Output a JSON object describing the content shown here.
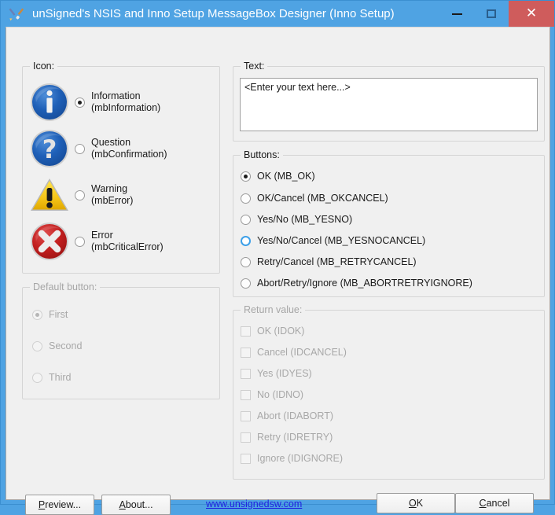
{
  "window": {
    "title": "unSigned's NSIS and Inno Setup MessageBox Designer (Inno Setup)",
    "app_icon": "paintbrush-pencil-icon",
    "titlebar_color": "#4fa3e3",
    "close_button_color": "#cf5c5c",
    "controls": {
      "minimize": "minimize-icon",
      "maximize": "maximize-icon",
      "close": "close-icon"
    }
  },
  "icon_group": {
    "legend": "Icon:",
    "options": [
      {
        "icon": "information-icon",
        "name": "Information",
        "constant": "(mbInformation)",
        "selected": true
      },
      {
        "icon": "question-icon",
        "name": "Question",
        "constant": "(mbConfirmation)",
        "selected": false
      },
      {
        "icon": "warning-icon",
        "name": "Warning",
        "constant": "(mbError)",
        "selected": false
      },
      {
        "icon": "error-icon",
        "name": "Error",
        "constant": "(mbCriticalError)",
        "selected": false
      }
    ]
  },
  "default_button_group": {
    "legend": "Default button:",
    "disabled": true,
    "options": [
      {
        "label": "First",
        "selected": true
      },
      {
        "label": "Second",
        "selected": false
      },
      {
        "label": "Third",
        "selected": false
      }
    ]
  },
  "text_group": {
    "legend": "Text:",
    "value": "<Enter your text here...>",
    "placeholder": "<Enter your text here...>"
  },
  "buttons_group": {
    "legend": "Buttons:",
    "options": [
      {
        "label": "OK (MB_OK)",
        "selected": true,
        "hover": false
      },
      {
        "label": "OK/Cancel (MB_OKCANCEL)",
        "selected": false,
        "hover": false
      },
      {
        "label": "Yes/No (MB_YESNO)",
        "selected": false,
        "hover": false
      },
      {
        "label": "Yes/No/Cancel (MB_YESNOCANCEL)",
        "selected": false,
        "hover": true
      },
      {
        "label": "Retry/Cancel (MB_RETRYCANCEL)",
        "selected": false,
        "hover": false
      },
      {
        "label": "Abort/Retry/Ignore (MB_ABORTRETRYIGNORE)",
        "selected": false,
        "hover": false
      }
    ]
  },
  "return_value_group": {
    "legend": "Return value:",
    "disabled": true,
    "options": [
      {
        "label": "OK (IDOK)",
        "checked": false
      },
      {
        "label": "Cancel (IDCANCEL)",
        "checked": false
      },
      {
        "label": "Yes (IDYES)",
        "checked": false
      },
      {
        "label": "No (IDNO)",
        "checked": false
      },
      {
        "label": "Abort (IDABORT)",
        "checked": false
      },
      {
        "label": "Retry (IDRETRY)",
        "checked": false
      },
      {
        "label": "Ignore (IDIGNORE)",
        "checked": false
      }
    ]
  },
  "footer": {
    "preview_button": {
      "accel": "P",
      "rest": "review..."
    },
    "about_button": {
      "accel": "A",
      "rest": "bout..."
    },
    "ok_button": {
      "accel": "O",
      "rest": "K"
    },
    "cancel_button": {
      "accel": "C",
      "rest": "ancel"
    },
    "link": "www.unsignedsw.com",
    "link_color": "#2020e0"
  }
}
